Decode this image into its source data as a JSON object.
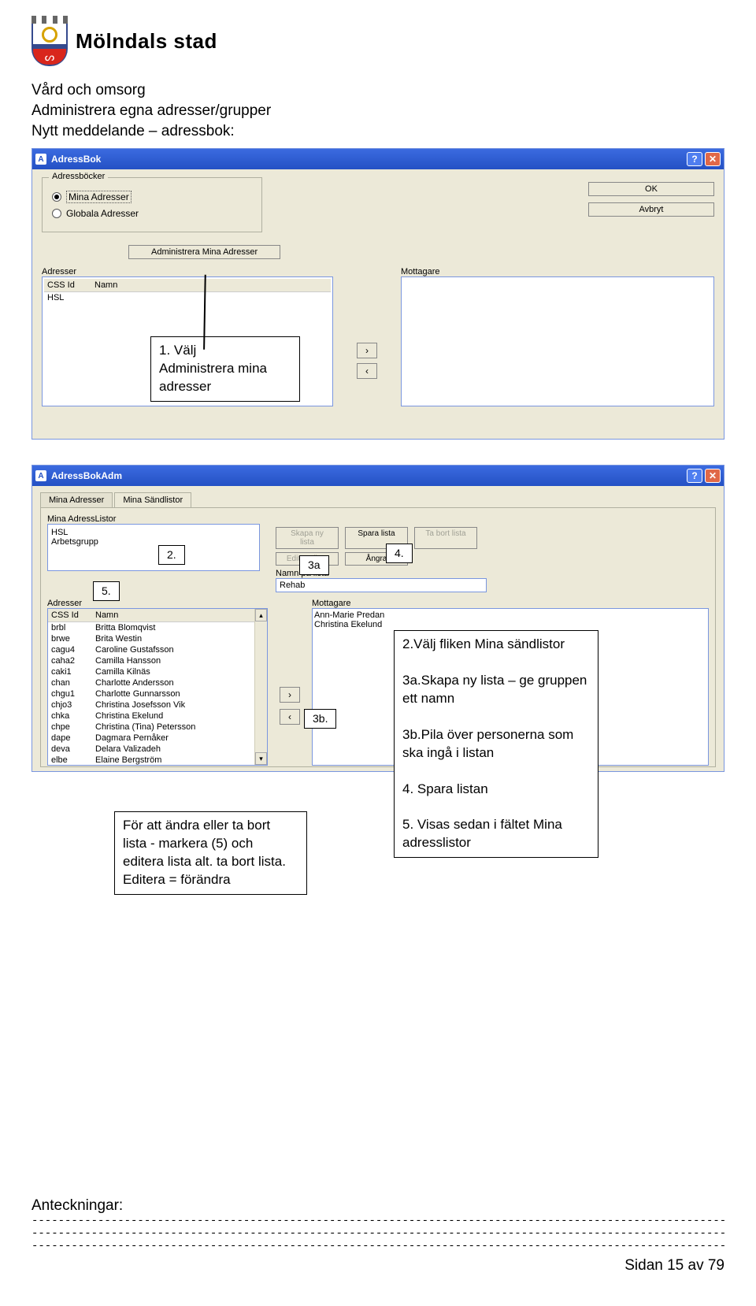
{
  "header": {
    "org": "Mölndals stad"
  },
  "intro": {
    "line1": "Vård och omsorg",
    "line2": "Administrera egna adresser/grupper",
    "line3": "Nytt meddelande – adressbok:"
  },
  "window1": {
    "title": "AdressBok",
    "group_label": "Adressböcker",
    "radio1": "Mina Adresser",
    "radio2": "Globala Adresser",
    "ok": "OK",
    "cancel": "Avbryt",
    "admin_btn": "Administrera Mina Adresser",
    "addresses_label": "Adresser",
    "recipients_label": "Mottagare",
    "css_id_header": "CSS Id",
    "name_header": "Namn",
    "list_item": "HSL",
    "arrow_right": "›",
    "arrow_left": "‹"
  },
  "callout1": {
    "text1": "1. Välj",
    "text2": "Administrera mina",
    "text3": "adresser"
  },
  "window2": {
    "title": "AdressBokAdm",
    "tab1": "Mina Adresser",
    "tab2": "Mina Sändlistor",
    "list_label": "Mina AdressListor",
    "list_items": [
      "HSL",
      "Arbetsgrupp"
    ],
    "create_btn": "Skapa ny lista",
    "save_btn": "Spara lista",
    "delete_btn": "Ta bort lista",
    "edit_btn": "Editera lista",
    "undo_btn": "Ångra",
    "name_label": "Namn på lista",
    "name_value": "Rehab",
    "addresses_label": "Adresser",
    "recipients_label": "Mottagare",
    "css_id_header": "CSS Id",
    "name_header": "Namn",
    "recipients": [
      "Ann-Marie Predan",
      "Christina Ekelund"
    ],
    "addresses": [
      {
        "id": "brbl",
        "name": "Britta Blomqvist"
      },
      {
        "id": "brwe",
        "name": "Brita Westin"
      },
      {
        "id": "cagu4",
        "name": "Caroline Gustafsson"
      },
      {
        "id": "caha2",
        "name": "Camilla Hansson"
      },
      {
        "id": "caki1",
        "name": "Camilla Kilnäs"
      },
      {
        "id": "chan",
        "name": "Charlotte Andersson"
      },
      {
        "id": "chgu1",
        "name": "Charlotte Gunnarsson"
      },
      {
        "id": "chjo3",
        "name": "Christina Josefsson Vik"
      },
      {
        "id": "chka",
        "name": "Christina Ekelund"
      },
      {
        "id": "chpe",
        "name": "Christina (Tina) Petersson"
      },
      {
        "id": "dape",
        "name": "Dagmara Pernåker"
      },
      {
        "id": "deva",
        "name": "Delara Valizadeh"
      },
      {
        "id": "elbe",
        "name": "Elaine Bergström"
      }
    ],
    "arrow_right": "›",
    "arrow_left": "‹"
  },
  "mini_callouts": {
    "c2": "2.",
    "c3a": "3a",
    "c4": "4.",
    "c5": "5.",
    "c3b": "3b."
  },
  "instruction_box": {
    "line1": "2.Välj fliken Mina sändlistor",
    "line2": "3a.Skapa ny lista – ge gruppen ett namn",
    "line3": "3b.Pila över personerna som ska ingå i listan",
    "line4": "4. Spara listan",
    "line5": "5. Visas sedan i fältet Mina adresslistor"
  },
  "edit_box": {
    "line1": "För att ändra eller ta bort",
    "line2": "lista - markera (5) och",
    "line3": "editera lista alt. ta bort lista.",
    "line4": "Editera = förändra"
  },
  "notes": {
    "label": "Anteckningar:"
  },
  "footer": {
    "text": "Sidan 15 av 79"
  }
}
